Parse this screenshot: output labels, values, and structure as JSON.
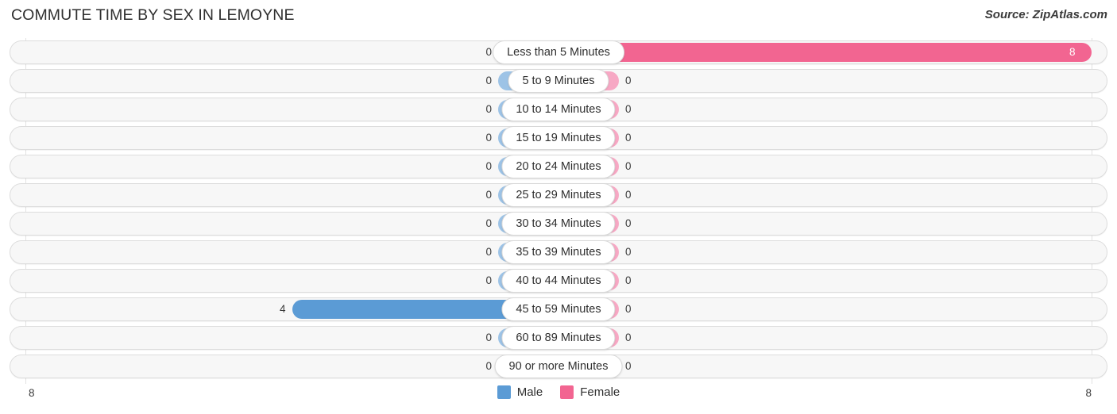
{
  "header": {
    "title": "COMMUTE TIME BY SEX IN LEMOYNE",
    "source": "Source: ZipAtlas.com"
  },
  "axis": {
    "left_label": "8",
    "right_label": "8"
  },
  "legend": {
    "items": [
      {
        "label": "Male",
        "color": "#5b9bd5"
      },
      {
        "label": "Female",
        "color": "#f26591"
      }
    ]
  },
  "colors": {
    "male_active": "#5b9bd5",
    "male_zero": "#9dc3e6",
    "female_active": "#f26591",
    "female_zero": "#f7a8c4",
    "track": "#f7f7f7",
    "track_border": "#dddddd",
    "gridline": "#e2e2e2"
  },
  "chart_data": {
    "type": "bar",
    "title": "COMMUTE TIME BY SEX IN LEMOYNE",
    "subtitle": "Source: ZipAtlas.com",
    "orientation": "horizontal-diverging",
    "xlabel": "",
    "ylabel": "",
    "xlim": [
      8,
      8
    ],
    "axis_ticks": [
      "8",
      "8"
    ],
    "grid": true,
    "legend_position": "bottom-center",
    "categories": [
      "Less than 5 Minutes",
      "5 to 9 Minutes",
      "10 to 14 Minutes",
      "15 to 19 Minutes",
      "20 to 24 Minutes",
      "25 to 29 Minutes",
      "30 to 34 Minutes",
      "35 to 39 Minutes",
      "40 to 44 Minutes",
      "45 to 59 Minutes",
      "60 to 89 Minutes",
      "90 or more Minutes"
    ],
    "series": [
      {
        "name": "Male",
        "color": "#5b9bd5",
        "side": "left",
        "values": [
          0,
          0,
          0,
          0,
          0,
          0,
          0,
          0,
          0,
          4,
          0,
          0
        ],
        "labels": [
          "0",
          "0",
          "0",
          "0",
          "0",
          "0",
          "0",
          "0",
          "0",
          "4",
          "0",
          "0"
        ]
      },
      {
        "name": "Female",
        "color": "#f26591",
        "side": "right",
        "values": [
          8,
          0,
          0,
          0,
          0,
          0,
          0,
          0,
          0,
          0,
          0,
          0
        ],
        "labels": [
          "8",
          "0",
          "0",
          "0",
          "0",
          "0",
          "0",
          "0",
          "0",
          "0",
          "0",
          "0"
        ]
      }
    ]
  }
}
